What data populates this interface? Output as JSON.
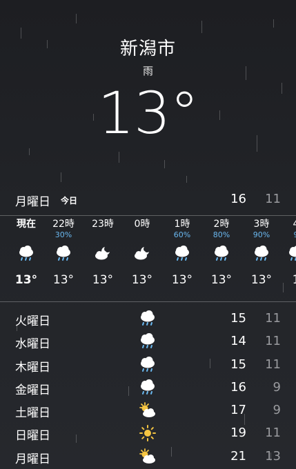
{
  "location": {
    "city": "新潟市",
    "condition": "雨",
    "temperature": "13°"
  },
  "today": {
    "day": "月曜日",
    "tag": "今日",
    "high": "16",
    "low": "11"
  },
  "hourly": [
    {
      "time": "現在",
      "pop": "",
      "icon": "rain-cloud-icon",
      "temp": "13°"
    },
    {
      "time": "22時",
      "pop": "30%",
      "icon": "rain-cloud-icon",
      "temp": "13°"
    },
    {
      "time": "23時",
      "pop": "",
      "icon": "cloudy-night-icon",
      "temp": "13°"
    },
    {
      "time": "0時",
      "pop": "",
      "icon": "cloudy-night-icon",
      "temp": "13°"
    },
    {
      "time": "1時",
      "pop": "60%",
      "icon": "rain-cloud-icon",
      "temp": "13°"
    },
    {
      "time": "2時",
      "pop": "80%",
      "icon": "rain-cloud-icon",
      "temp": "13°"
    },
    {
      "time": "3時",
      "pop": "90%",
      "icon": "rain-cloud-icon",
      "temp": "13°"
    },
    {
      "time": "4",
      "pop": "9",
      "icon": "rain-cloud-icon",
      "temp": "1"
    }
  ],
  "daily": [
    {
      "day": "火曜日",
      "icon": "rain-cloud-icon",
      "high": "15",
      "low": "11"
    },
    {
      "day": "水曜日",
      "icon": "rain-cloud-icon",
      "high": "14",
      "low": "11"
    },
    {
      "day": "木曜日",
      "icon": "rain-cloud-icon",
      "high": "15",
      "low": "11"
    },
    {
      "day": "金曜日",
      "icon": "rain-cloud-icon",
      "high": "16",
      "low": "9"
    },
    {
      "day": "土曜日",
      "icon": "partly-sunny-icon",
      "high": "17",
      "low": "9"
    },
    {
      "day": "日曜日",
      "icon": "sun-icon",
      "high": "19",
      "low": "11"
    },
    {
      "day": "月曜日",
      "icon": "partly-sunny-icon",
      "high": "21",
      "low": "13"
    }
  ],
  "colors": {
    "background": "#222428",
    "precipitation": "#6ab8f0",
    "low_temp": "#9a9b9f",
    "sun": "#f5c542"
  }
}
